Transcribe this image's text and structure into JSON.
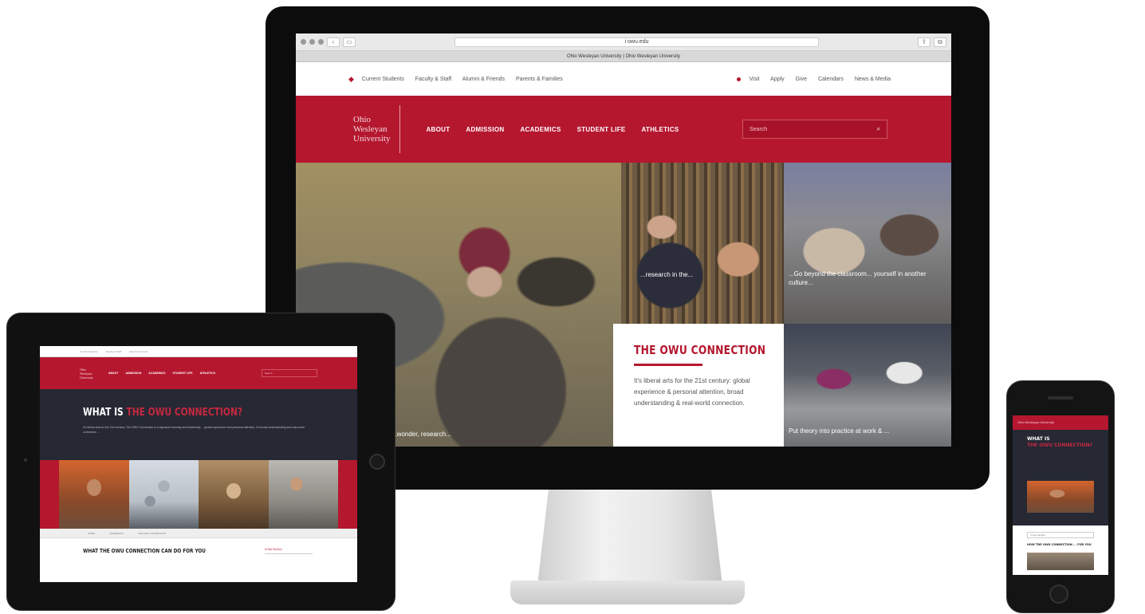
{
  "browser": {
    "url": "i owu.edu",
    "tab_title": "Ohio Wesleyan University | Ohio Wesleyan University"
  },
  "desktop": {
    "util_left": [
      "Current Students",
      "Faculty & Staff",
      "Alumni & Friends",
      "Parents & Families"
    ],
    "util_right": [
      "Visit",
      "Apply",
      "Give",
      "Calendars",
      "News & Media"
    ],
    "logo": [
      "Ohio",
      "Wesleyan",
      "University"
    ],
    "nav": [
      "ABOUT",
      "ADMISSION",
      "ACADEMICS",
      "STUDENT LIFE",
      "ATHLETICS"
    ],
    "search_placeholder": "Search",
    "hero": {
      "caption_left": "...wonder, research...",
      "caption_tr1": "...research in the...",
      "caption_tr2": "...Go beyond the classroom... yourself in another culture...",
      "caption_br": "Put theory into practice at work & ...",
      "card_title": "THE OWU CONNECTION",
      "card_text": "It's liberal arts for the 21st century: global experience & personal attention, broad understanding & real-world connection."
    }
  },
  "tablet": {
    "nav": [
      "ABOUT",
      "ADMISSION",
      "ACADEMICS",
      "STUDENT LIFE",
      "ATHLETICS"
    ],
    "heading_white": "WHAT IS ",
    "heading_red": "THE OWU CONNECTION?",
    "body": "It's liberal arts for the 21st century. The OWU Connection is a signature learning and leadership ... global experience and personal attention, it's broad understanding and real-world connection ...",
    "crumbs": [
      "HOME",
      "ACADEMICS",
      "THE OWU CONNECTION"
    ],
    "bottom_title": "WHAT THE OWU CONNECTION CAN DO FOR YOU"
  },
  "phone": {
    "header": "Ohio Wesleyan University",
    "heading_white": "WHAT IS",
    "heading_red": "THE OWU CONNECTION?",
    "bar": "In this Section",
    "sub": "HOW THE OWU CONNECTION ... FOR YOU"
  },
  "colors": {
    "brand_red": "#b5172f",
    "dark_navy": "#262834"
  },
  "icons": [
    "search-icon",
    "owu-mark-icon",
    "red-dot-icon",
    "home-button-icon"
  ]
}
